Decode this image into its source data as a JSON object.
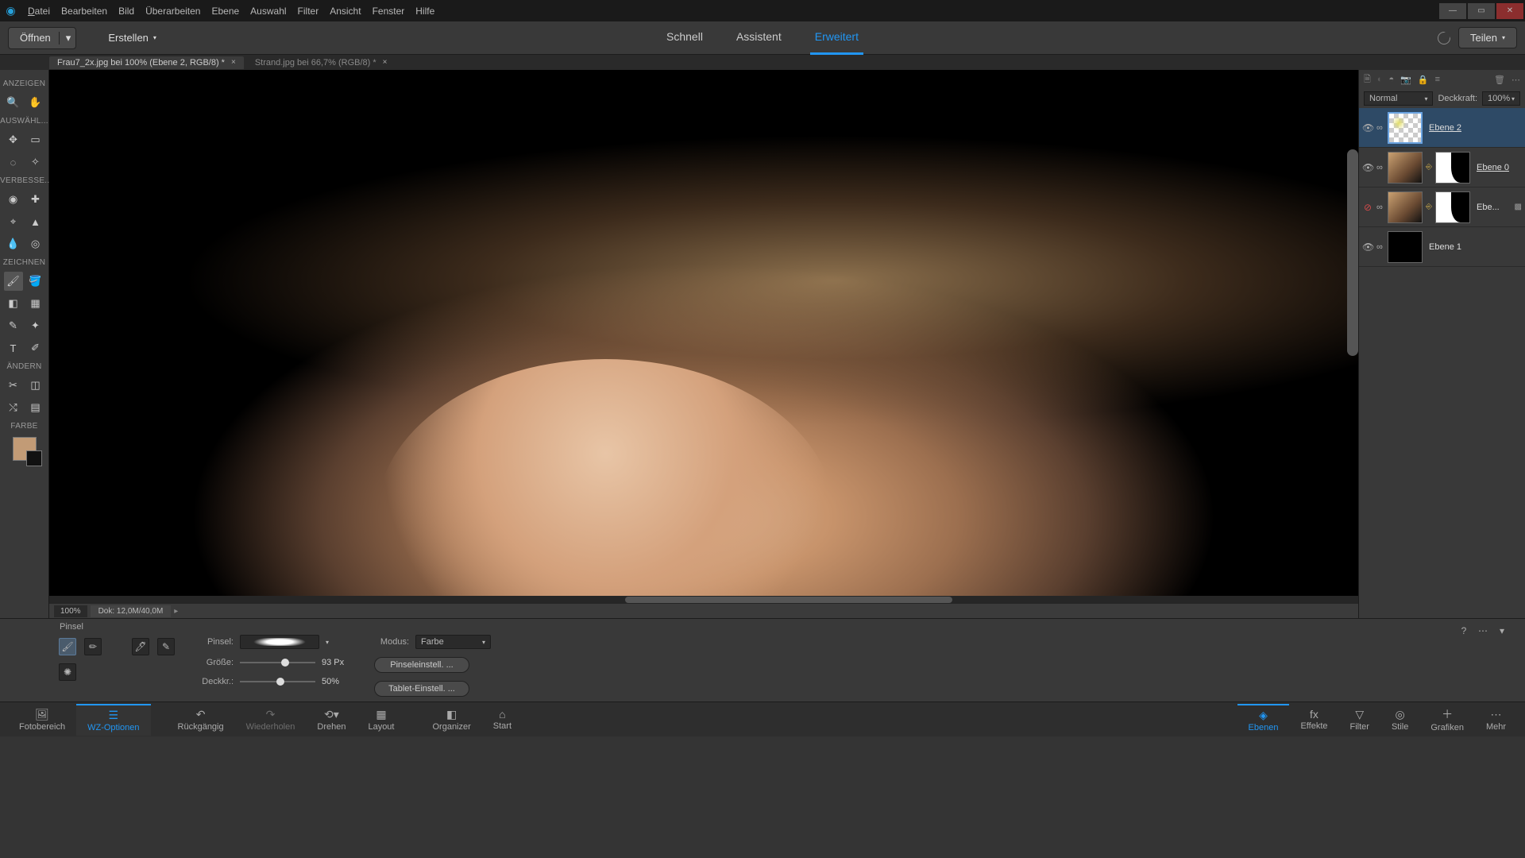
{
  "menu": {
    "datei": "Datei",
    "bearbeiten": "Bearbeiten",
    "bild": "Bild",
    "ueberarbeiten": "Überarbeiten",
    "ebene": "Ebene",
    "auswahl": "Auswahl",
    "filter": "Filter",
    "ansicht": "Ansicht",
    "fenster": "Fenster",
    "hilfe": "Hilfe"
  },
  "toolbar": {
    "open": "Öffnen",
    "create": "Erstellen",
    "share": "Teilen"
  },
  "modes": {
    "quick": "Schnell",
    "guided": "Assistent",
    "expert": "Erweitert"
  },
  "docs": {
    "t1": "Frau7_2x.jpg bei 100% (Ebene 2, RGB/8) *",
    "t2": "Strand.jpg bei 66,7% (RGB/8) *"
  },
  "toolgroups": {
    "anzeigen": "ANZEIGEN",
    "auswaehl": "AUSWÄHL...",
    "verbesse": "VERBESSE...",
    "zeichnen": "ZEICHNEN",
    "aendern": "ÄNDERN",
    "farbe": "FARBE"
  },
  "status": {
    "zoom": "100%",
    "doc": "Dok: 12,0M/40,0M"
  },
  "layerpanel": {
    "blend": "Normal",
    "opacity_lbl": "Deckkraft:",
    "opacity": "100%",
    "l0": "Ebene 2",
    "l1": "Ebene 0",
    "l2": "Ebe...",
    "l3": "Ebene 1"
  },
  "options": {
    "title": "Pinsel",
    "brush_lbl": "Pinsel:",
    "mode_lbl": "Modus:",
    "mode_val": "Farbe",
    "size_lbl": "Größe:",
    "size_val": "93 Px",
    "opac_lbl": "Deckkr.:",
    "opac_val": "50%",
    "brushset": "Pinseleinstell. ...",
    "tablet": "Tablet-Einstell. ..."
  },
  "bottom": {
    "foto": "Fotobereich",
    "wz": "WZ-Optionen",
    "undo": "Rückgängig",
    "redo": "Wiederholen",
    "rotate": "Drehen",
    "layout": "Layout",
    "organizer": "Organizer",
    "start": "Start",
    "ebenen": "Ebenen",
    "effekte": "Effekte",
    "filter": "Filter",
    "stile": "Stile",
    "grafiken": "Grafiken",
    "mehr": "Mehr"
  }
}
